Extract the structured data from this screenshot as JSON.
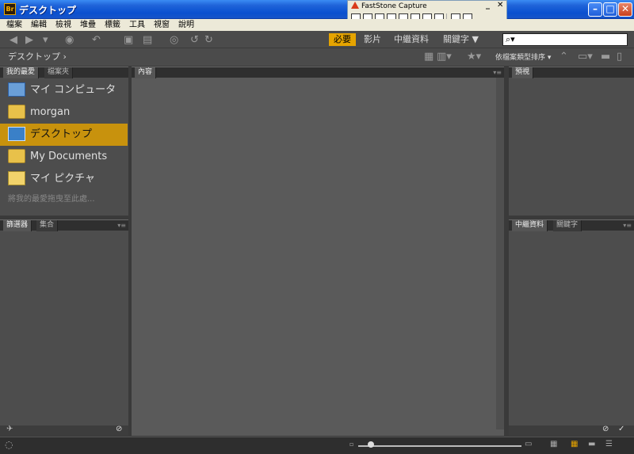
{
  "window": {
    "title": "デスクトップ",
    "app_icon_text": "Br"
  },
  "faststone": {
    "title": "FastStone Capture",
    "minimize": "_",
    "close": "✕"
  },
  "menu": [
    "檔案",
    "編輯",
    "檢視",
    "堆疊",
    "標籤",
    "工具",
    "視窗",
    "說明"
  ],
  "toolbar": {
    "workspaces": [
      {
        "label": "必要",
        "active": true
      },
      {
        "label": "影片",
        "active": false
      },
      {
        "label": "中繼資料",
        "active": false
      },
      {
        "label": "關鍵字 ▼",
        "active": false
      }
    ],
    "search_placeholder": ""
  },
  "path": {
    "breadcrumb": "デスクトップ ›",
    "sort_label": "依檔案類型排序 ▾"
  },
  "left_top_panel": {
    "tabs": [
      "我的最愛",
      "檔案夾"
    ],
    "items": [
      {
        "label": "マイ コンピュータ",
        "icon": "computer-icon"
      },
      {
        "label": "morgan",
        "icon": "folder-icon"
      },
      {
        "label": "デスクトップ",
        "icon": "desktop-icon",
        "selected": true
      },
      {
        "label": "My Documents",
        "icon": "folder-icon"
      },
      {
        "label": "マイ ピクチャ",
        "icon": "pictures-icon"
      }
    ],
    "hint": "將我的最愛拖曳至此處..."
  },
  "left_bottom_panel": {
    "tabs": [
      "篩選器",
      "集合"
    ]
  },
  "content_panel": {
    "tabs": [
      "內容"
    ]
  },
  "right_top_panel": {
    "tabs": [
      "預視"
    ]
  },
  "right_bottom_panel": {
    "tabs": [
      "中繼資料",
      "關鍵字"
    ]
  },
  "colors": {
    "accent": "#e6a400",
    "panel": "#4d4d4d",
    "selected": "#c8920d"
  }
}
